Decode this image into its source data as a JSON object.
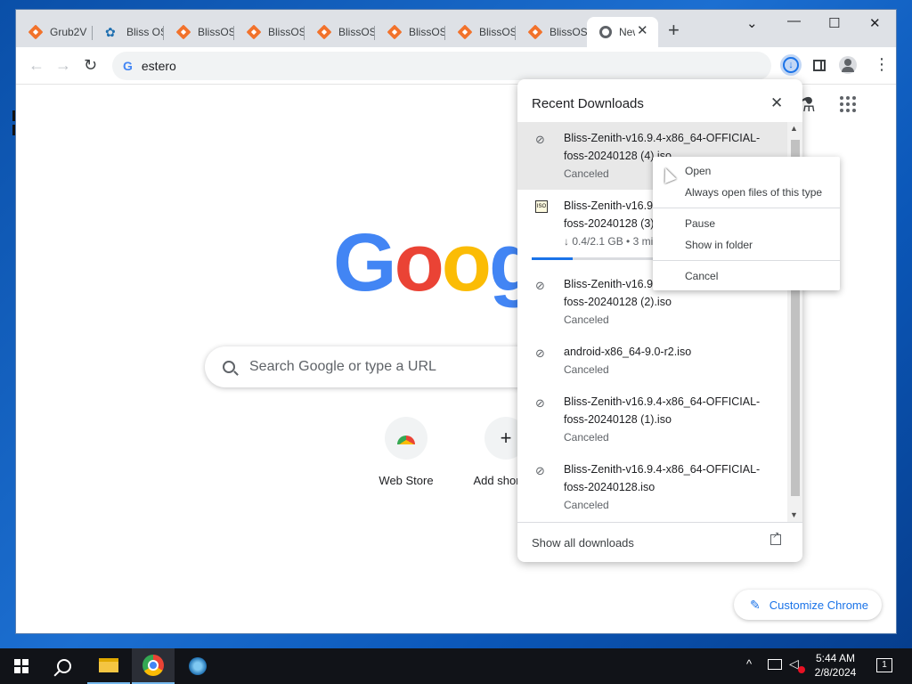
{
  "tabs": [
    {
      "title": "Grub2V",
      "icon": "diamond-icon"
    },
    {
      "title": "Bliss OS",
      "icon": "bliss-icon"
    },
    {
      "title": "BlissOS",
      "icon": "diamond-icon"
    },
    {
      "title": "BlissOS",
      "icon": "diamond-icon"
    },
    {
      "title": "BlissOS",
      "icon": "diamond-icon"
    },
    {
      "title": "BlissOS",
      "icon": "diamond-icon"
    },
    {
      "title": "BlissOS",
      "icon": "diamond-icon"
    },
    {
      "title": "BlissOS",
      "icon": "diamond-icon"
    },
    {
      "title": "New",
      "icon": "chrome-icon",
      "active": true
    }
  ],
  "toolbar": {
    "address": "estero"
  },
  "ntp": {
    "logo": [
      "G",
      "o",
      "o",
      "g"
    ],
    "logo_colors": [
      "#4285f4",
      "#ea4335",
      "#fbbc05",
      "#4285f4"
    ],
    "search_placeholder": "Search Google or type a URL",
    "shortcuts": [
      {
        "label": "Web Store"
      },
      {
        "label": "Add shortcut"
      }
    ],
    "customize_label": "Customize Chrome"
  },
  "downloads": {
    "title": "Recent Downloads",
    "footer_link": "Show all downloads",
    "items": [
      {
        "name": "Bliss-Zenith-v16.9.4-x86_64-OFFICIAL-foss-20240128 (4).iso",
        "status": "Canceled",
        "highlighted": true
      },
      {
        "name": "Bliss-Zenith-v16.9.4-x86_64-OFFICIAL-foss-20240128 (3).iso",
        "status": "↓ 0.4/2.1 GB • 3 min",
        "in_progress": true,
        "progress": 0.17
      },
      {
        "name": "Bliss-Zenith-v16.9.4-x86_64-OFFICIAL-foss-20240128 (2).iso",
        "status": "Canceled"
      },
      {
        "name": "android-x86_64-9.0-r2.iso",
        "status": "Canceled"
      },
      {
        "name": "Bliss-Zenith-v16.9.4-x86_64-OFFICIAL-foss-20240128 (1).iso",
        "status": "Canceled"
      },
      {
        "name": "Bliss-Zenith-v16.9.4-x86_64-OFFICIAL-foss-20240128.iso",
        "status": "Canceled"
      }
    ]
  },
  "context_menu": {
    "open": "Open",
    "always_open": "Always open files of this type",
    "pause": "Pause",
    "show_in_folder": "Show in folder",
    "cancel": "Cancel"
  },
  "taskbar": {
    "time": "5:44 AM",
    "date": "2/8/2024",
    "notifications": "1"
  }
}
